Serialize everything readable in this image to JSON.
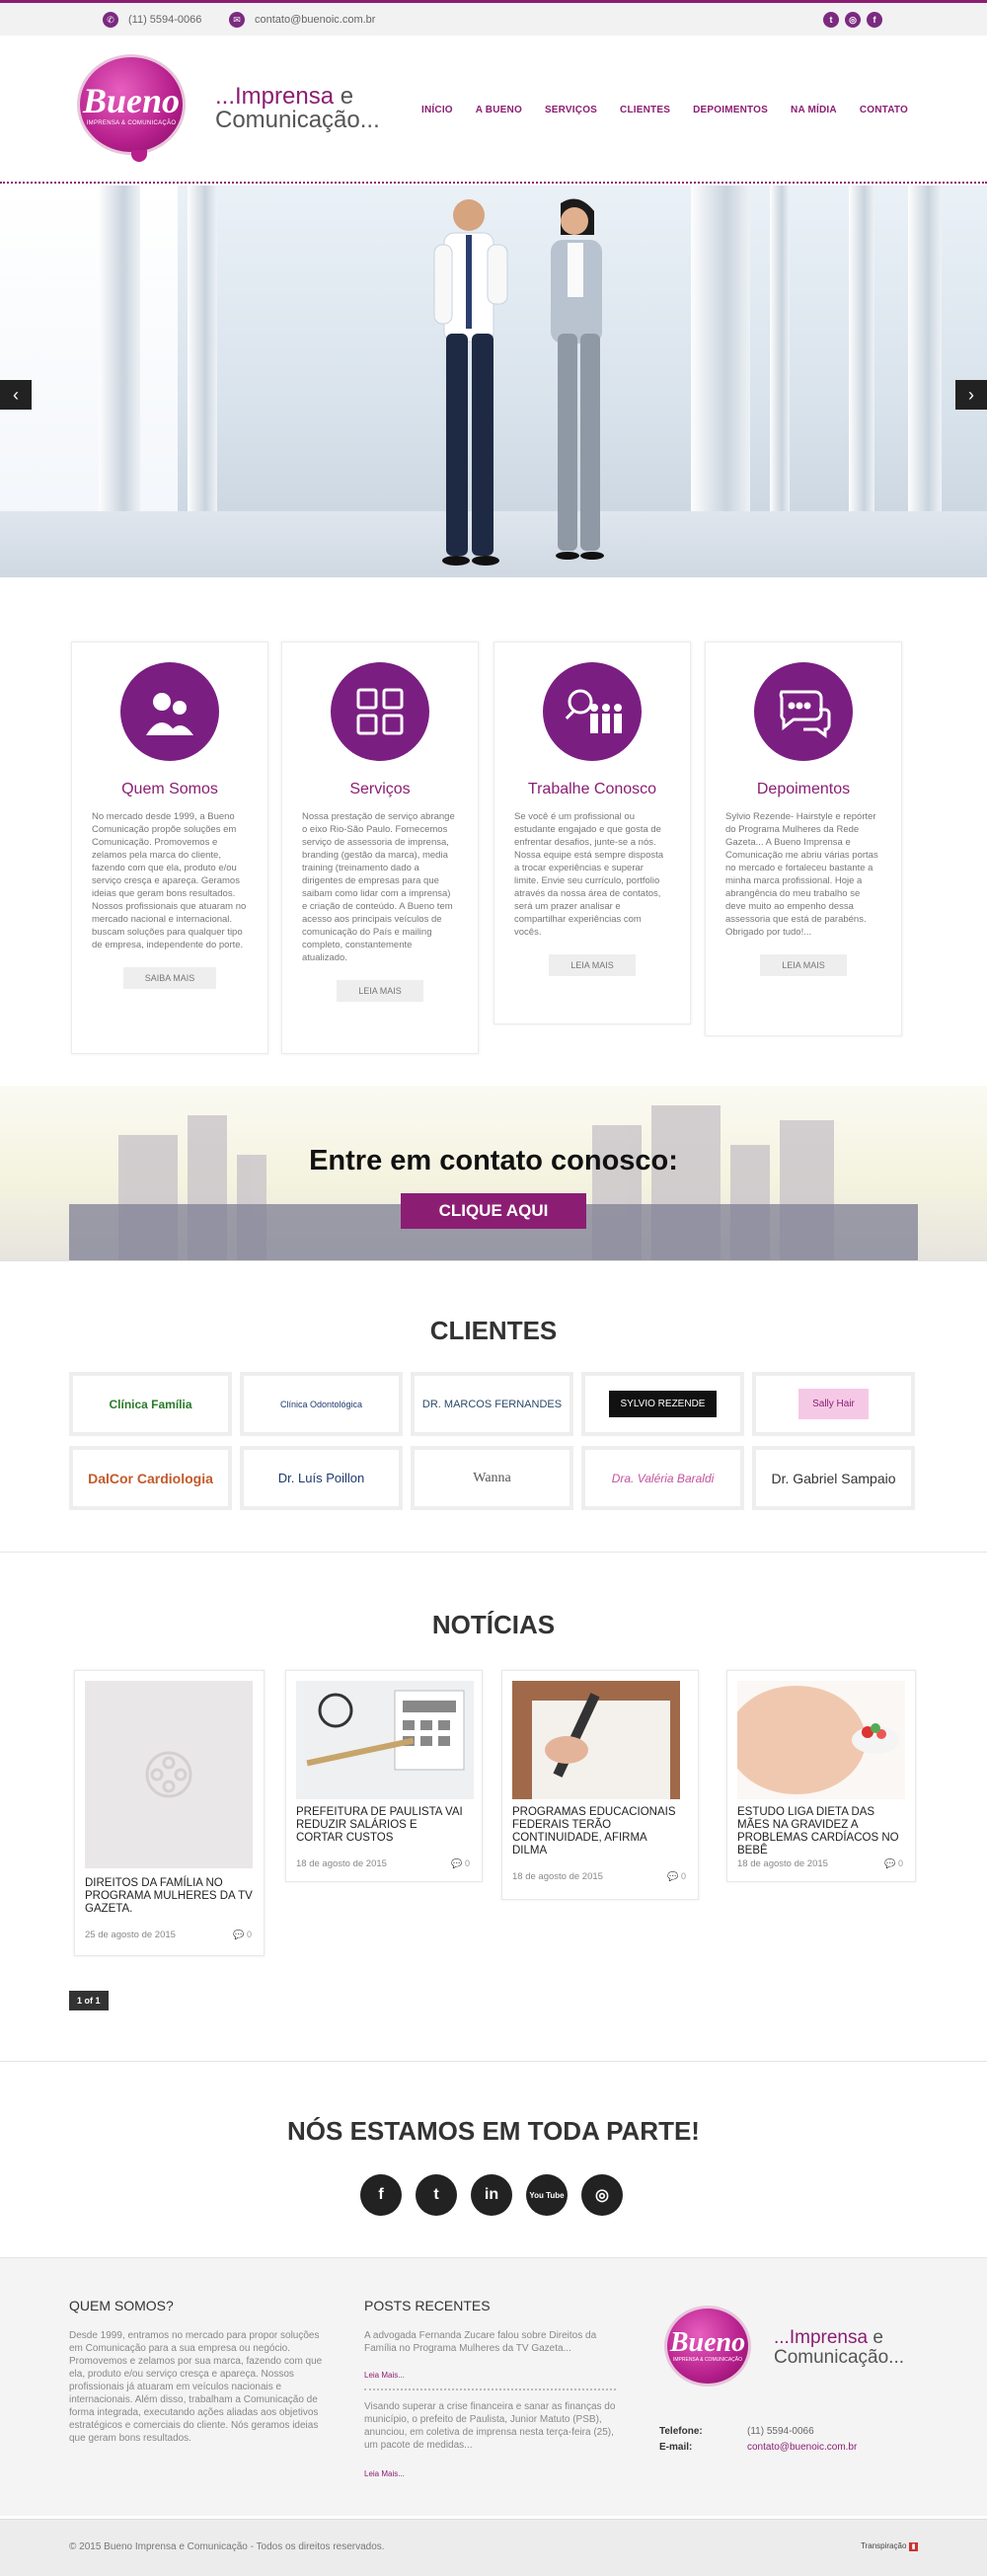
{
  "topbar": {
    "phone": "(11) 5594-0066",
    "email": "contato@buenoic.com.br",
    "social": [
      "twitter-icon",
      "instagram-icon",
      "facebook-icon"
    ]
  },
  "brand": {
    "logo_text": "Bueno",
    "logo_sub": "IMPRENSA & COMUNICAÇÃO",
    "tagline_prefix": "...",
    "tagline_line1": "Imprensa",
    "tagline_e": " e",
    "tagline_line2": "Comunicação..."
  },
  "nav": [
    "INÍCIO",
    "A BUENO",
    "SERVIÇOS",
    "CLIENTES",
    "DEPOIMENTOS",
    "NA MÍDIA",
    "CONTATO"
  ],
  "slider": {
    "prev": "‹",
    "next": "›"
  },
  "features": [
    {
      "title": "Quem Somos",
      "icon": "people-icon",
      "text": "No mercado desde 1999, a Bueno Comunicação propõe soluções em Comunicação. Promovemos e zelamos pela marca do cliente, fazendo com que ela, produto e/ou serviço cresça e apareça. Geramos ideias que geram bons resultados. Nossos profissionais que atuaram no mercado nacional e internacional. buscam soluções para qualquer tipo de empresa, independente do porte.",
      "button": "SAIBA MAIS"
    },
    {
      "title": "Serviços",
      "icon": "apps-grid-icon",
      "text": "Nossa prestação de serviço abrange o eixo Rio-São Paulo. Fornecemos serviço de assessoria de imprensa, branding (gestão da marca), media training (treinamento dado a dirigentes de empresas para que saibam como lidar com a imprensa) e criação de conteúdo. A Bueno tem acesso aos principais veículos de comunicação do País e mailing completo, constantemente atualizado.",
      "button": "LEIA MAIS"
    },
    {
      "title": "Trabalhe Conosco",
      "icon": "team-search-icon",
      "text": "Se você é um profissional ou estudante engajado e que gosta de enfrentar desafios, junte-se a nós. Nossa equipe está sempre disposta a trocar experiências e superar limite. Envie seu currículo, portfolio através da nossa área de contatos, será um prazer analisar e compartilhar experiências com vocês.",
      "button": "LEIA MAIS"
    },
    {
      "title": "Depoimentos",
      "icon": "chat-bubbles-icon",
      "text": "Sylvio Rezende- Hairstyle e repórter do Programa Mulheres da Rede Gazeta... A Bueno Imprensa e Comunicação me abriu várias portas no mercado e fortaleceu bastante a minha marca profissional. Hoje a abrangência do meu trabalho se deve muito ao empenho dessa assessoria que está de parabéns. Obrigado por tudo!...",
      "button": "LEIA MAIS"
    }
  ],
  "cta": {
    "title": "Entre em contato conosco:",
    "button": "CLIQUE AQUI"
  },
  "clients": {
    "title": "CLIENTES",
    "items": [
      "Clínica Família",
      "Clínica Odontológica",
      "DR. MARCOS FERNANDES",
      "SYLVIO REZENDE",
      "Sally Hair",
      "DalCor Cardiologia",
      "Dr. Luís Poillon",
      "Wanna",
      "Dra. Valéria Baraldi",
      "Dr. Gabriel Sampaio"
    ]
  },
  "news": {
    "title": "NOTÍCIAS",
    "items": [
      {
        "title": "DIREITOS DA FAMÍLIA NO PROGRAMA MULHERES DA TV GAZETA.",
        "date": "25 de agosto de 2015",
        "comments": "0"
      },
      {
        "title": "PREFEITURA DE PAULISTA VAI REDUZIR SALÁRIOS E CORTAR CUSTOS",
        "date": "18 de agosto de 2015",
        "comments": "0"
      },
      {
        "title": "PROGRAMAS EDUCACIONAIS FEDERAIS TERÃO CONTINUIDADE, AFIRMA DILMA",
        "date": "18 de agosto de 2015",
        "comments": "0"
      },
      {
        "title": "ESTUDO LIGA DIETA DAS MÃES NA GRAVIDEZ A PROBLEMAS CARDÍACOS NO BEBÊ",
        "date": "18 de agosto de 2015",
        "comments": "0"
      }
    ],
    "pager": "1 of 1"
  },
  "everywhere": {
    "title": "NÓS ESTAMOS EM TODA PARTE!",
    "networks": [
      "f",
      "t",
      "in",
      "You Tube",
      "◎"
    ]
  },
  "footer": {
    "about_title": "QUEM SOMOS?",
    "about_text": "Desde 1999, entramos no mercado para propor soluções em Comunicação para a sua empresa ou negócio. Promovemos e zelamos por sua marca, fazendo com que ela, produto e/ou serviço cresça e apareça. Nossos profissionais já atuaram em veículos nacionais e internacionais. Além disso, trabalham a Comunicação de forma integrada, executando ações aliadas aos objetivos estratégicos e comerciais do cliente. Nós geramos ideias que geram bons resultados.",
    "posts_title": "POSTS RECENTES",
    "post1": "A advogada Fernanda Zucare falou sobre Direitos da Família no Programa Mulheres da TV Gazeta...",
    "post1_link": "Leia Mais...",
    "post2": "Visando superar a crise financeira e sanar as finanças do município, o prefeito de Paulista, Junior Matuto (PSB), anunciou, em coletiva de imprensa nesta terça-feira (25), um pacote de medidas...",
    "post2_link": "Leia Mais...",
    "phone_label": "Telefone:",
    "phone": "(11) 5594-0066",
    "email_label": "E-mail:",
    "email": "contato@buenoic.com.br"
  },
  "bottom": {
    "copyright": "© 2015 Bueno Imprensa e Comunicação - Todos os direitos reservados.",
    "credit": "Transpiração"
  }
}
